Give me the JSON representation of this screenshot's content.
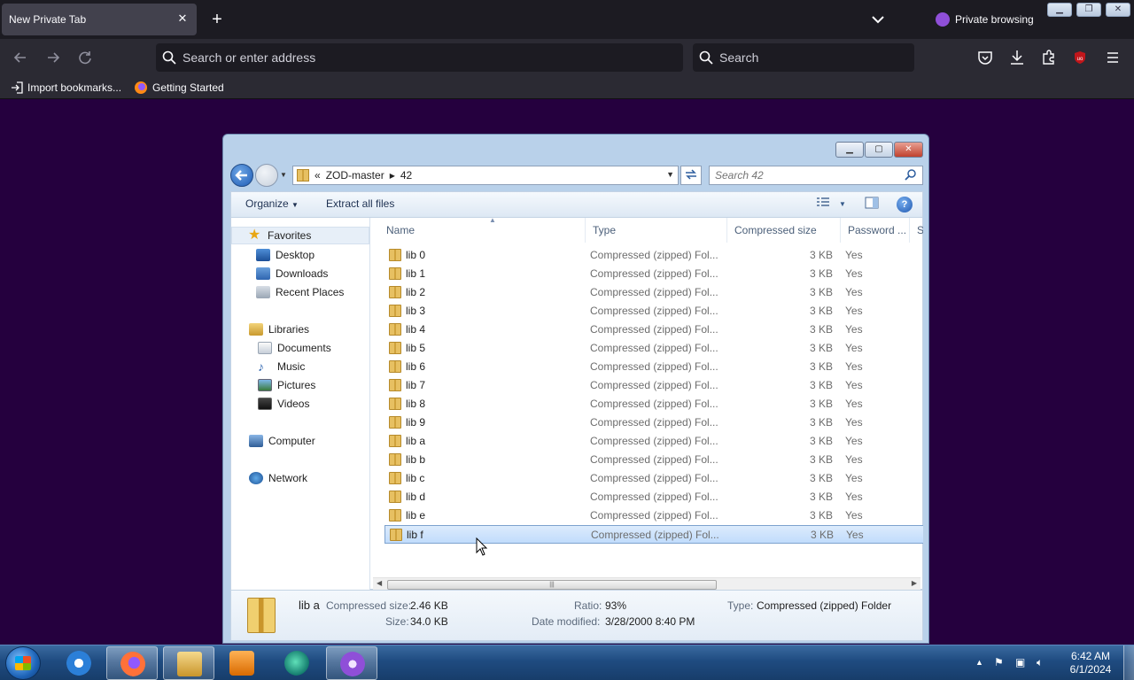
{
  "browser": {
    "tab_title": "New Private Tab",
    "tab_close": "✕",
    "new_tab": "+",
    "private_label": "Private browsing",
    "url_placeholder": "Search or enter address",
    "search_placeholder": "Search",
    "bookmarks": [
      {
        "label": "Import bookmarks..."
      },
      {
        "label": "Getting Started"
      }
    ]
  },
  "explorer": {
    "breadcrumb": [
      "ZOD-master",
      "42"
    ],
    "breadcrumb_prefix": "«",
    "search_placeholder": "Search 42",
    "toolbar": {
      "organize": "Organize",
      "extract": "Extract all files"
    },
    "nav": {
      "favorites": "Favorites",
      "desktop": "Desktop",
      "downloads": "Downloads",
      "recent": "Recent Places",
      "libraries": "Libraries",
      "documents": "Documents",
      "music": "Music",
      "pictures": "Pictures",
      "videos": "Videos",
      "computer": "Computer",
      "network": "Network"
    },
    "columns": {
      "name": "Name",
      "type": "Type",
      "compressed": "Compressed size",
      "password": "Password ...",
      "size": "Si"
    },
    "files": [
      {
        "name": "lib 0",
        "type": "Compressed (zipped) Fol...",
        "csize": "3 KB",
        "pw": "Yes"
      },
      {
        "name": "lib 1",
        "type": "Compressed (zipped) Fol...",
        "csize": "3 KB",
        "pw": "Yes"
      },
      {
        "name": "lib 2",
        "type": "Compressed (zipped) Fol...",
        "csize": "3 KB",
        "pw": "Yes"
      },
      {
        "name": "lib 3",
        "type": "Compressed (zipped) Fol...",
        "csize": "3 KB",
        "pw": "Yes"
      },
      {
        "name": "lib 4",
        "type": "Compressed (zipped) Fol...",
        "csize": "3 KB",
        "pw": "Yes"
      },
      {
        "name": "lib 5",
        "type": "Compressed (zipped) Fol...",
        "csize": "3 KB",
        "pw": "Yes"
      },
      {
        "name": "lib 6",
        "type": "Compressed (zipped) Fol...",
        "csize": "3 KB",
        "pw": "Yes"
      },
      {
        "name": "lib 7",
        "type": "Compressed (zipped) Fol...",
        "csize": "3 KB",
        "pw": "Yes"
      },
      {
        "name": "lib 8",
        "type": "Compressed (zipped) Fol...",
        "csize": "3 KB",
        "pw": "Yes"
      },
      {
        "name": "lib 9",
        "type": "Compressed (zipped) Fol...",
        "csize": "3 KB",
        "pw": "Yes"
      },
      {
        "name": "lib a",
        "type": "Compressed (zipped) Fol...",
        "csize": "3 KB",
        "pw": "Yes"
      },
      {
        "name": "lib b",
        "type": "Compressed (zipped) Fol...",
        "csize": "3 KB",
        "pw": "Yes"
      },
      {
        "name": "lib c",
        "type": "Compressed (zipped) Fol...",
        "csize": "3 KB",
        "pw": "Yes"
      },
      {
        "name": "lib d",
        "type": "Compressed (zipped) Fol...",
        "csize": "3 KB",
        "pw": "Yes"
      },
      {
        "name": "lib e",
        "type": "Compressed (zipped) Fol...",
        "csize": "3 KB",
        "pw": "Yes"
      },
      {
        "name": "lib f",
        "type": "Compressed (zipped) Fol...",
        "csize": "3 KB",
        "pw": "Yes",
        "selected": true
      }
    ],
    "details": {
      "name": "lib a",
      "compressed_label": "Compressed size:",
      "compressed_value": "2.46 KB",
      "size_label": "Size:",
      "size_value": "34.0 KB",
      "ratio_label": "Ratio:",
      "ratio_value": "93%",
      "modified_label": "Date modified:",
      "modified_value": "3/28/2000 8:40 PM",
      "type_label": "Type:",
      "type_value": "Compressed (zipped) Folder"
    }
  },
  "taskbar": {
    "time": "6:42 AM",
    "date": "6/1/2024"
  }
}
